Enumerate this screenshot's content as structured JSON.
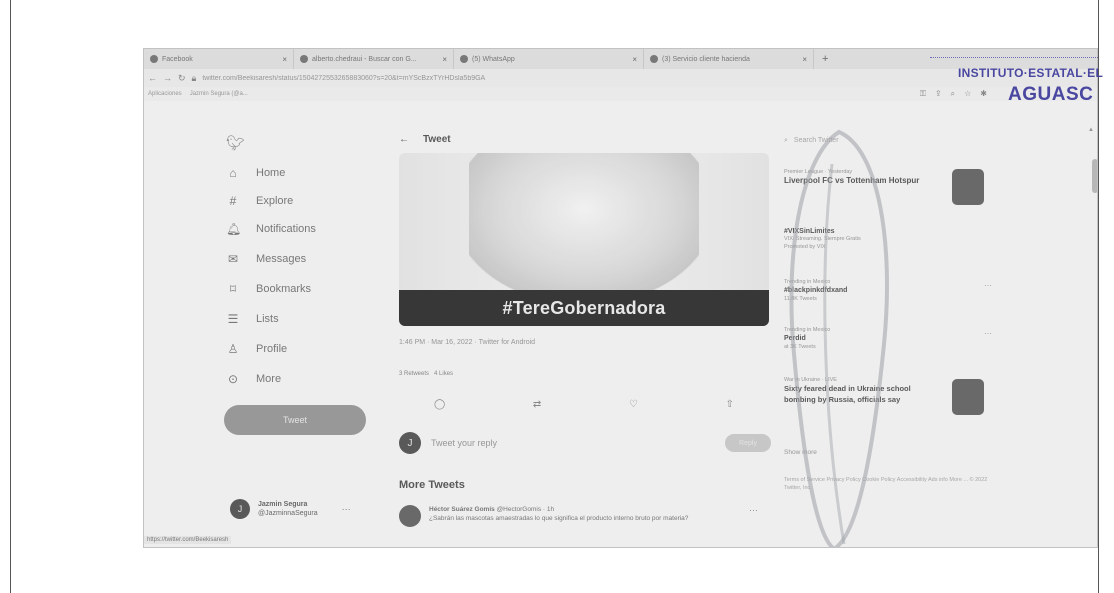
{
  "tabs": [
    {
      "label": "Facebook",
      "icon": "facebook-icon"
    },
    {
      "label": "alberto.chedraui - Buscar con G...",
      "icon": "google-icon"
    },
    {
      "label": "(5) WhatsApp",
      "icon": "whatsapp-icon"
    },
    {
      "label": "(3) Servicio cliente hacienda",
      "icon": "tab-icon"
    }
  ],
  "address": {
    "url": "twitter.com/Beekisaresh/status/1504272553265883060?s=20&t=mYScBzxTYrHDsla5b9GA"
  },
  "bookmarks": [
    "Aplicaciones",
    "Jazmin Segura (@a..."
  ],
  "sidebar": {
    "items": [
      {
        "label": "Home",
        "icon": "home-icon"
      },
      {
        "label": "Explore",
        "icon": "hashtag-icon"
      },
      {
        "label": "Notifications",
        "icon": "bell-icon"
      },
      {
        "label": "Messages",
        "icon": "envelope-icon"
      },
      {
        "label": "Bookmarks",
        "icon": "bookmark-icon"
      },
      {
        "label": "Lists",
        "icon": "list-icon"
      },
      {
        "label": "Profile",
        "icon": "person-icon"
      },
      {
        "label": "More",
        "icon": "more-circle-icon"
      }
    ],
    "tweet_button": "Tweet",
    "account": {
      "initial": "J",
      "name": "Jazmin Segura",
      "handle": "@JazminnaSegura"
    }
  },
  "status_url": "https://twitter.com/Beekisaresh",
  "tweet": {
    "header": "Tweet",
    "image_caption": "#TereGobernadora",
    "timestamp": "1:46 PM · Mar 16, 2022 · Twitter for Android",
    "retweets": "3 Retweets",
    "likes": "4 Likes",
    "reply_initial": "J",
    "reply_placeholder": "Tweet your reply",
    "reply_button": "Reply"
  },
  "more_tweets": {
    "title": "More Tweets",
    "item": {
      "author": "Héctor Suárez Gomís",
      "handle": "@HectorGomis · 1h",
      "text": "¿Sabrán las mascotas amaestradas lo que significa el producto interno bruto por materia?"
    }
  },
  "right": {
    "search_placeholder": "Search Twitter",
    "trends": [
      {
        "context": "Premier League · Yesterday",
        "title": "Liverpool FC vs Tottenham Hotspur",
        "sub": ""
      },
      {
        "context": "",
        "title": "#VIXSinLimites",
        "sub": "VIX: Streaming. Siempre Gratis"
      },
      {
        "context": "Trending in Mexico",
        "title": "#blackpinkdfdxand",
        "sub": "11.8K Tweets"
      },
      {
        "context": "Trending in Mexico",
        "title": "Perdid",
        "sub": "at 3K Tweets"
      },
      {
        "context": "War in Ukraine · LIVE",
        "title": "Sixty feared dead in Ukraine school bombing by Russia, officials say",
        "sub": ""
      }
    ],
    "promoted": "Promoted by VIX",
    "show_more": "Show more",
    "footer": "Terms of Service  Privacy Policy  Cookie Policy  Accessibility  Ads info  More ...  © 2022 Twitter, Inc."
  },
  "watermark": {
    "line1": "INSTITUTO·ESTATAL·EL",
    "line2": "AGUASC"
  }
}
